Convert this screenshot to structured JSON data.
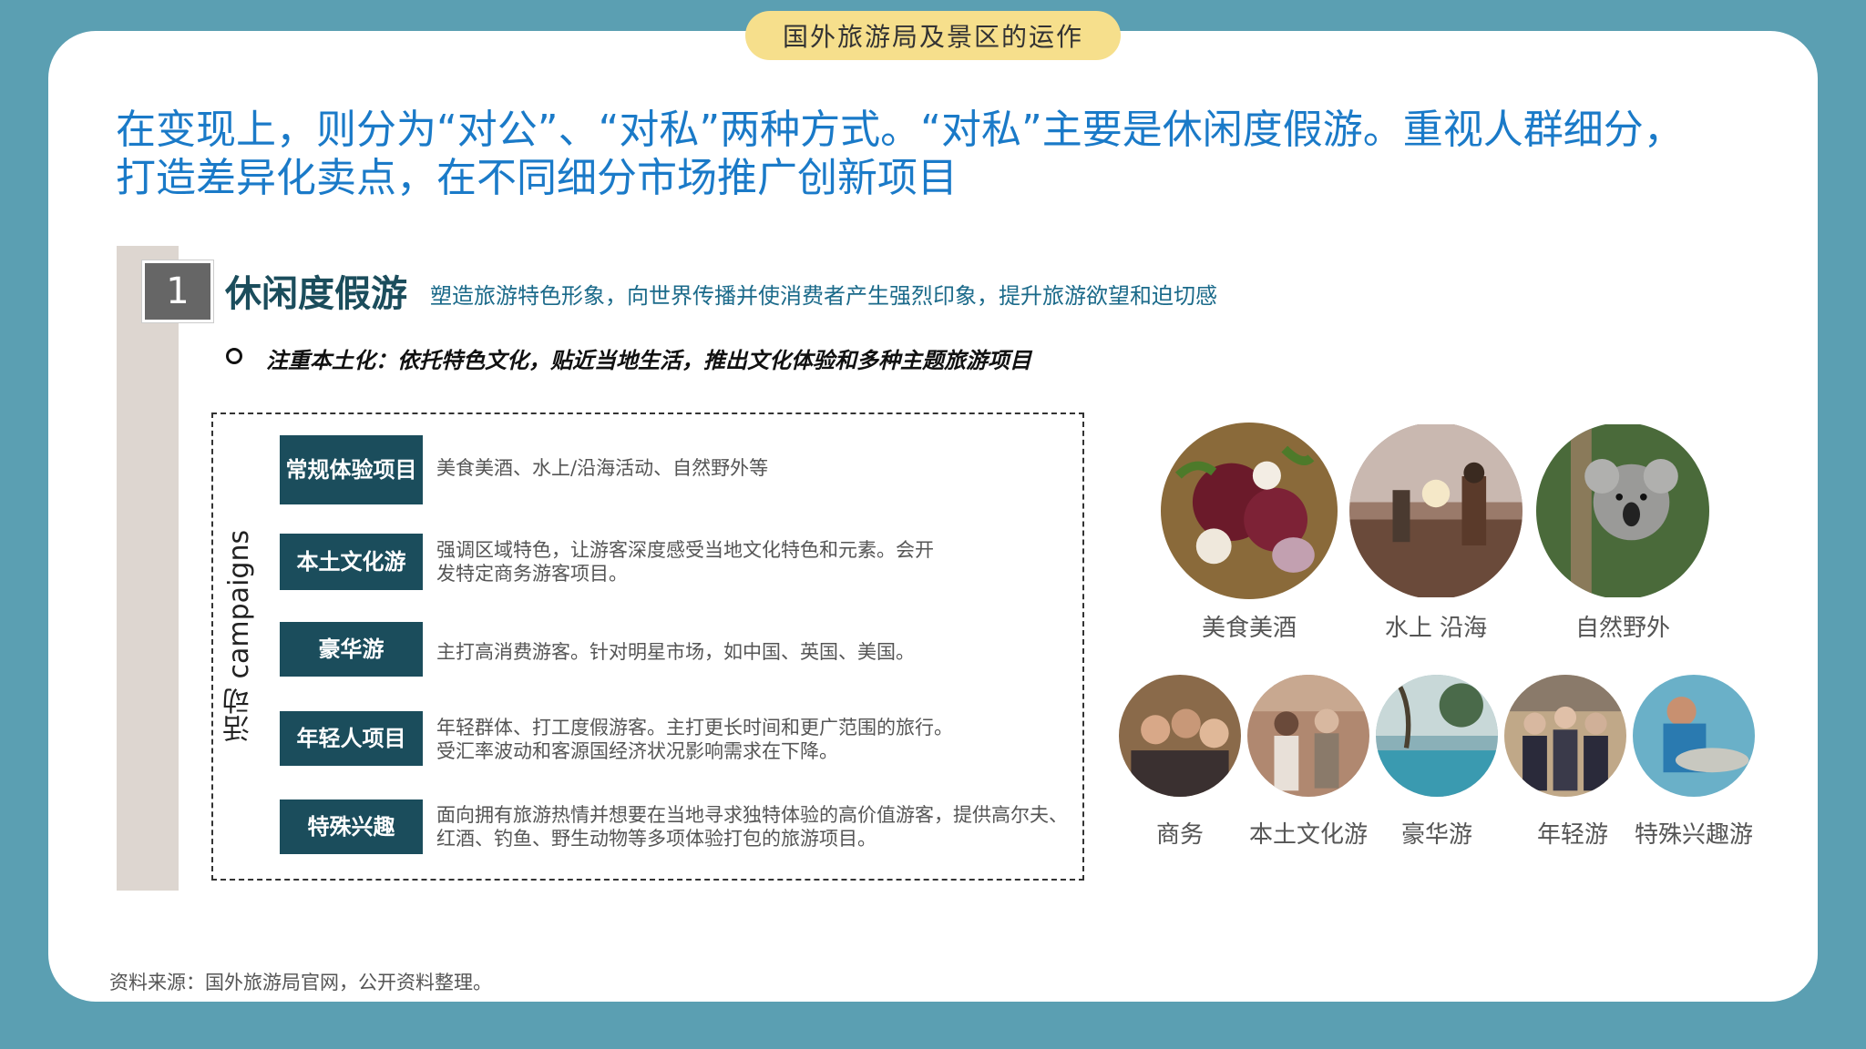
{
  "header": {
    "tab_title": "国外旅游局及景区的运作"
  },
  "headline": {
    "line1": "在变现上，则分为“对公”、“对私”两种方式。“对私”主要是休闲度假游。重视人群细分，",
    "line2": "打造差异化卖点，在不同细分市场推广创新项目"
  },
  "section": {
    "number": "1",
    "title": "休闲度假游",
    "subtitle": "塑造旅游特色形象，向世界传播并使消费者产生强烈印象，提升旅游欲望和迫切感",
    "bullet": "注重本土化：依托特色文化，贴近当地生活，推出文化体验和多种主题旅游项目"
  },
  "campaigns": {
    "vertical_label": "活动 campaigns",
    "items": [
      {
        "label": "常规体验项目",
        "desc": "美食美酒、水上/沿海活动、自然野外等"
      },
      {
        "label": "本土文化游",
        "desc": "强调区域特色，让游客深度感受当地文化特色和元素。会开发特定商务游客项目。"
      },
      {
        "label": "豪华游",
        "desc": "主打高消费游客。针对明星市场，如中国、英国、美国。"
      },
      {
        "label": "年轻人项目",
        "desc": "年轻群体、打工度假游客。主打更长时间和更广范围的旅行。受汇率波动和客源国经济状况影响需求在下降。"
      },
      {
        "label": "特殊兴趣",
        "desc": "面向拥有旅游热情并想要在当地寻求独特体验的高价值游客，提供高尔夫、红酒、钓鱼、野生动物等多项体验打包的旅游项目。"
      }
    ]
  },
  "photos_top": [
    {
      "caption": "美食美酒",
      "icon": "food-photo"
    },
    {
      "caption": "水上 沿海",
      "icon": "beach-photo"
    },
    {
      "caption": "自然野外",
      "icon": "koala-photo"
    }
  ],
  "photos_bottom": [
    {
      "caption": "商务",
      "icon": "business-photo"
    },
    {
      "caption": "本土文化游",
      "icon": "culture-photo"
    },
    {
      "caption": "豪华游",
      "icon": "luxury-pool-photo"
    },
    {
      "caption": "年轻游",
      "icon": "youth-group-photo"
    },
    {
      "caption": "特殊兴趣游",
      "icon": "fishing-photo"
    }
  ],
  "footer": {
    "source": "资料来源：国外旅游局官网，公开资料整理。"
  },
  "colors": {
    "background": "#5b9fb2",
    "tab": "#f6df8c",
    "headline": "#1a7ac8",
    "label_bg": "#1b4d5c"
  }
}
